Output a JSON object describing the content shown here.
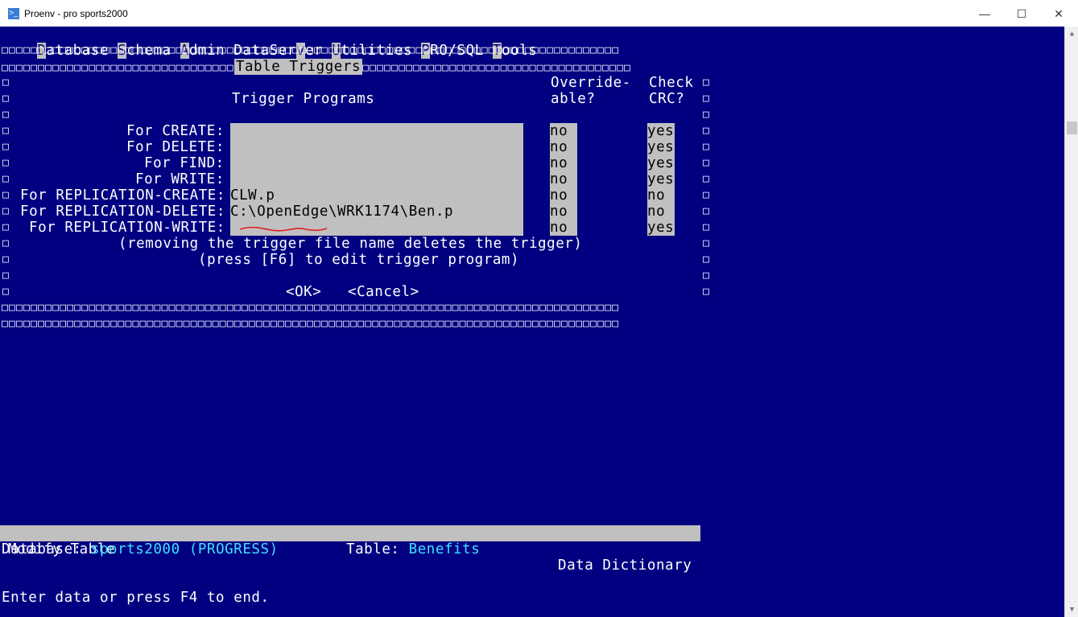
{
  "window": {
    "title": "Proenv - pro  sports2000"
  },
  "menu": [
    {
      "hot": "D",
      "rest": "atabase"
    },
    {
      "hot": "S",
      "rest": "chema"
    },
    {
      "hot": "A",
      "rest": "dmin"
    },
    {
      "pre": "DataSer",
      "hot": "v",
      "rest": "er"
    },
    {
      "hot": "U",
      "rest": "tilities"
    },
    {
      "hot": "P",
      "rest": "RO/SQL"
    },
    {
      "hot": "T",
      "rest": "ools"
    }
  ],
  "dialog": {
    "title": "Table Triggers",
    "headers": {
      "programs": "Trigger Programs",
      "override_1": "Override-",
      "override_2": "able?",
      "crc_1": "Check",
      "crc_2": "CRC?"
    },
    "rows": [
      {
        "label": "For CREATE:",
        "program": "",
        "overridable": "no",
        "crc": "yes"
      },
      {
        "label": "For DELETE:",
        "program": "",
        "overridable": "no",
        "crc": "yes"
      },
      {
        "label": "For FIND:",
        "program": "",
        "overridable": "no",
        "crc": "yes"
      },
      {
        "label": "For WRITE:",
        "program": "",
        "overridable": "no",
        "crc": "yes"
      },
      {
        "label": "For REPLICATION-CREATE:",
        "program": "CLW.p",
        "overridable": "no",
        "crc": "no"
      },
      {
        "label": "For REPLICATION-DELETE:",
        "program": "C:\\OpenEdge\\WRK1174\\Ben.p",
        "overridable": "no",
        "crc": "no"
      },
      {
        "label": "For REPLICATION-WRITE:",
        "program": "",
        "overridable": "no",
        "crc": "yes"
      }
    ],
    "note1": "(removing the trigger file name deletes the trigger)",
    "note2": "(press [F6] to edit trigger program)",
    "ok": "<OK>",
    "cancel": "<Cancel>"
  },
  "status": {
    "left": "Modify Table",
    "right": "Data Dictionary",
    "db_label": "Database:",
    "db_value": "sports2000 (PROGRESS)",
    "table_label": "Table:",
    "table_value": "Benefits",
    "message": "Enter data or press F4 to end."
  },
  "colors": {
    "background": "#000080",
    "field": "#c0c0c0",
    "highlight": "#40e0ff",
    "annotation": "#e02020"
  }
}
